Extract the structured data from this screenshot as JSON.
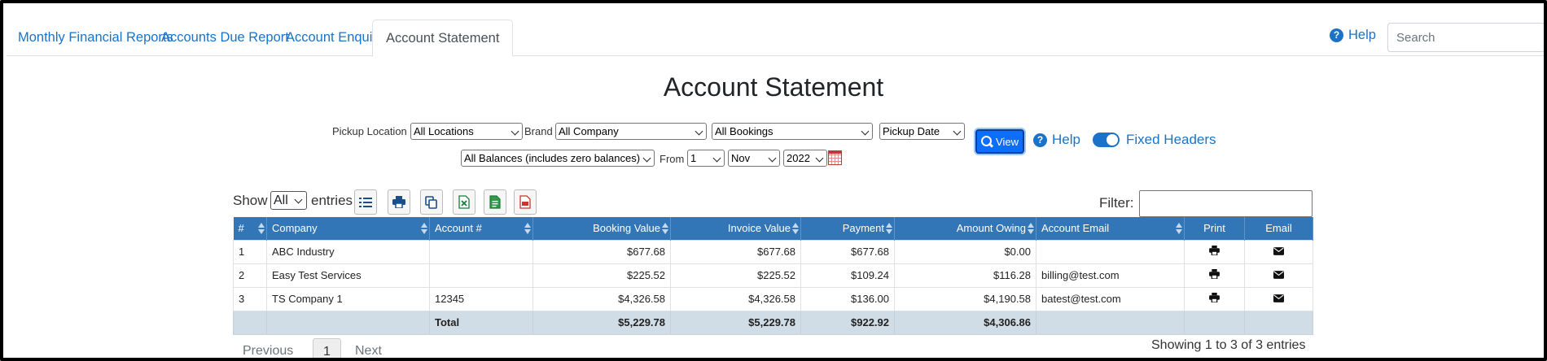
{
  "tabs": [
    {
      "label": "Monthly Financial Reports"
    },
    {
      "label": "Accounts Due Report"
    },
    {
      "label": "Account Enquiry"
    },
    {
      "label": "Account Statement"
    }
  ],
  "top": {
    "help_label": "Help",
    "search_placeholder": "Search"
  },
  "page_title": "Account Statement",
  "filters": {
    "pickup_location_label": "Pickup Location",
    "pickup_location_value": "All Locations",
    "brand_label": "Brand",
    "brand_value": "All Company",
    "bookings_value": "All Bookings",
    "date_type_value": "Pickup Date",
    "balances_value": "All Balances (includes zero balances)",
    "from_label": "From",
    "day_value": "1",
    "month_value": "Nov",
    "year_value": "2022",
    "view_label": "View",
    "help_label": "Help",
    "fixed_headers_label": "Fixed Headers",
    "fixed_headers_on": true
  },
  "toolbar": {
    "show_label": "Show",
    "show_value": "All",
    "entries_label": "entries",
    "filter_label": "Filter:"
  },
  "table": {
    "headers": [
      "#",
      "Company",
      "Account #",
      "Booking Value",
      "Invoice Value",
      "Payment",
      "Amount Owing",
      "Account Email",
      "Print",
      "Email"
    ],
    "rows": [
      {
        "num": "1",
        "company": "ABC Industry",
        "account": "",
        "booking": "$677.68",
        "invoice": "$677.68",
        "payment": "$677.68",
        "owing": "$0.00",
        "email": ""
      },
      {
        "num": "2",
        "company": "Easy Test Services",
        "account": "",
        "booking": "$225.52",
        "invoice": "$225.52",
        "payment": "$109.24",
        "owing": "$116.28",
        "email": "billing@test.com"
      },
      {
        "num": "3",
        "company": "TS Company 1",
        "account": "12345",
        "booking": "$4,326.58",
        "invoice": "$4,326.58",
        "payment": "$136.00",
        "owing": "$4,190.58",
        "email": "batest@test.com"
      }
    ],
    "total": {
      "label": "Total",
      "booking": "$5,229.78",
      "invoice": "$5,229.78",
      "payment": "$922.92",
      "owing": "$4,306.86"
    }
  },
  "pagination": {
    "previous": "Previous",
    "current": "1",
    "next": "Next",
    "info": "Showing 1 to 3 of 3 entries"
  },
  "colors": {
    "accent": "#1a73c8",
    "header_bg": "#3376b8",
    "total_bg": "#d1dde6",
    "view_button": "#0d6efd"
  }
}
